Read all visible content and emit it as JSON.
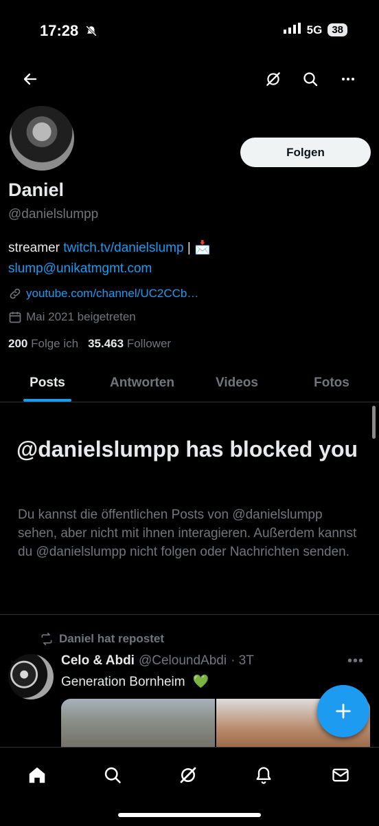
{
  "status_bar": {
    "time": "17:28",
    "network": "5G",
    "battery": "38"
  },
  "profile": {
    "name": "Daniel",
    "handle": "@danielslumpp",
    "follow_label": "Folgen",
    "bio": {
      "prefix": "streamer ",
      "twitch_link": "twitch.tv/danielslump",
      "separator": " | ",
      "email_emoji": "📩",
      "email_link": "slump@unikatmgmt.com"
    },
    "website": "youtube.com/channel/UC2CCb…",
    "joined": "Mai 2021 beigetreten",
    "following_count": "200",
    "following_label": "Folge ich",
    "followers_count": "35.463",
    "followers_label": "Follower"
  },
  "tabs": [
    {
      "label": "Posts"
    },
    {
      "label": "Antworten"
    },
    {
      "label": "Videos"
    },
    {
      "label": "Fotos"
    }
  ],
  "blocked_notice": {
    "title": "@danielslumpp has blocked you",
    "text": "Du kannst die öffentlichen Posts von @danielslumpp sehen, aber nicht mit ihnen interagieren. Außerdem kannst du @danielslumpp nicht folgen oder Nachrichten senden."
  },
  "post": {
    "repost_label": "Daniel hat repostet",
    "author": "Celo & Abdi",
    "handle": "@CeloundAbdi",
    "time": "· 3T",
    "text": "Generation Bornheim",
    "emoji": "💚"
  },
  "colors": {
    "accent": "#1d9bf0",
    "background": "#000000",
    "muted": "#71767b"
  }
}
